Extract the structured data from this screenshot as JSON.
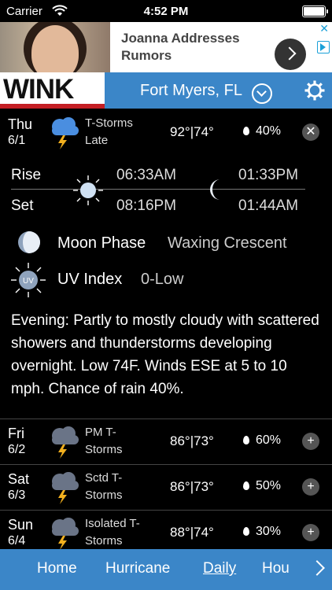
{
  "status_bar": {
    "carrier": "Carrier",
    "time": "4:52 PM"
  },
  "ad": {
    "headline": "Joanna Addresses Rumors"
  },
  "header": {
    "logo_text": "WINK",
    "location": "Fort Myers, FL"
  },
  "today": {
    "day": "Thu",
    "date": "6/1",
    "condition": "T-Storms Late",
    "temps": "92°|74°",
    "rain": "40%"
  },
  "sun_moon": {
    "rise_label": "Rise",
    "set_label": "Set",
    "sunrise": "06:33AM",
    "sunset": "08:16PM",
    "moonrise": "01:33PM",
    "moonset": "01:44AM"
  },
  "details": {
    "moon_phase_label": "Moon Phase",
    "moon_phase_value": "Waxing Crescent",
    "uv_label": "UV Index",
    "uv_value": "0-Low",
    "uv_badge": "UV"
  },
  "forecast_text": "Evening: Partly to mostly cloudy with scattered showers and thunderstorms developing overnight. Low 74F. Winds ESE at 5 to 10 mph. Chance of rain 40%.",
  "days": [
    {
      "day": "Fri",
      "date": "6/2",
      "condition": "PM T-Storms",
      "temps": "86°|73°",
      "rain": "60%"
    },
    {
      "day": "Sat",
      "date": "6/3",
      "condition": "Sctd T-Storms",
      "temps": "86°|73°",
      "rain": "50%"
    },
    {
      "day": "Sun",
      "date": "6/4",
      "condition": "Isolated T-Storms",
      "temps": "88°|74°",
      "rain": "30%"
    }
  ],
  "nav": {
    "items": [
      "Home",
      "Hurricane",
      "Daily",
      "Hou"
    ],
    "active": "Daily"
  },
  "colors": {
    "header_blue": "#3b86c8",
    "logo_red": "#c41e24",
    "background": "#000000"
  }
}
